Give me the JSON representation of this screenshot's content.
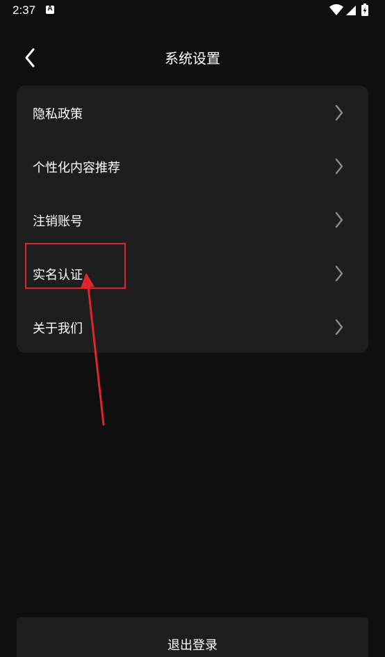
{
  "status_bar": {
    "time": "2:37",
    "notification_icon": "a-notification-icon",
    "wifi_icon": "wifi-icon",
    "signal_icon": "signal-icon",
    "battery_icon": "battery-charging-icon"
  },
  "header": {
    "title": "系统设置",
    "back_icon": "chevron-left-icon"
  },
  "menu": {
    "items": [
      {
        "label": "隐私政策"
      },
      {
        "label": "个性化内容推荐"
      },
      {
        "label": "注销账号"
      },
      {
        "label": "实名认证"
      },
      {
        "label": "关于我们"
      }
    ],
    "chevron_icon": "chevron-right-icon",
    "chevron_color": "#8a8a8a",
    "card_color": "#1e1e1e"
  },
  "annotation": {
    "color": "#e0262c",
    "highlighted_item": "实名认证"
  },
  "footer": {
    "logout_label": "退出登录"
  },
  "colors": {
    "background": "#0f0f0f",
    "text": "#ffffff"
  }
}
